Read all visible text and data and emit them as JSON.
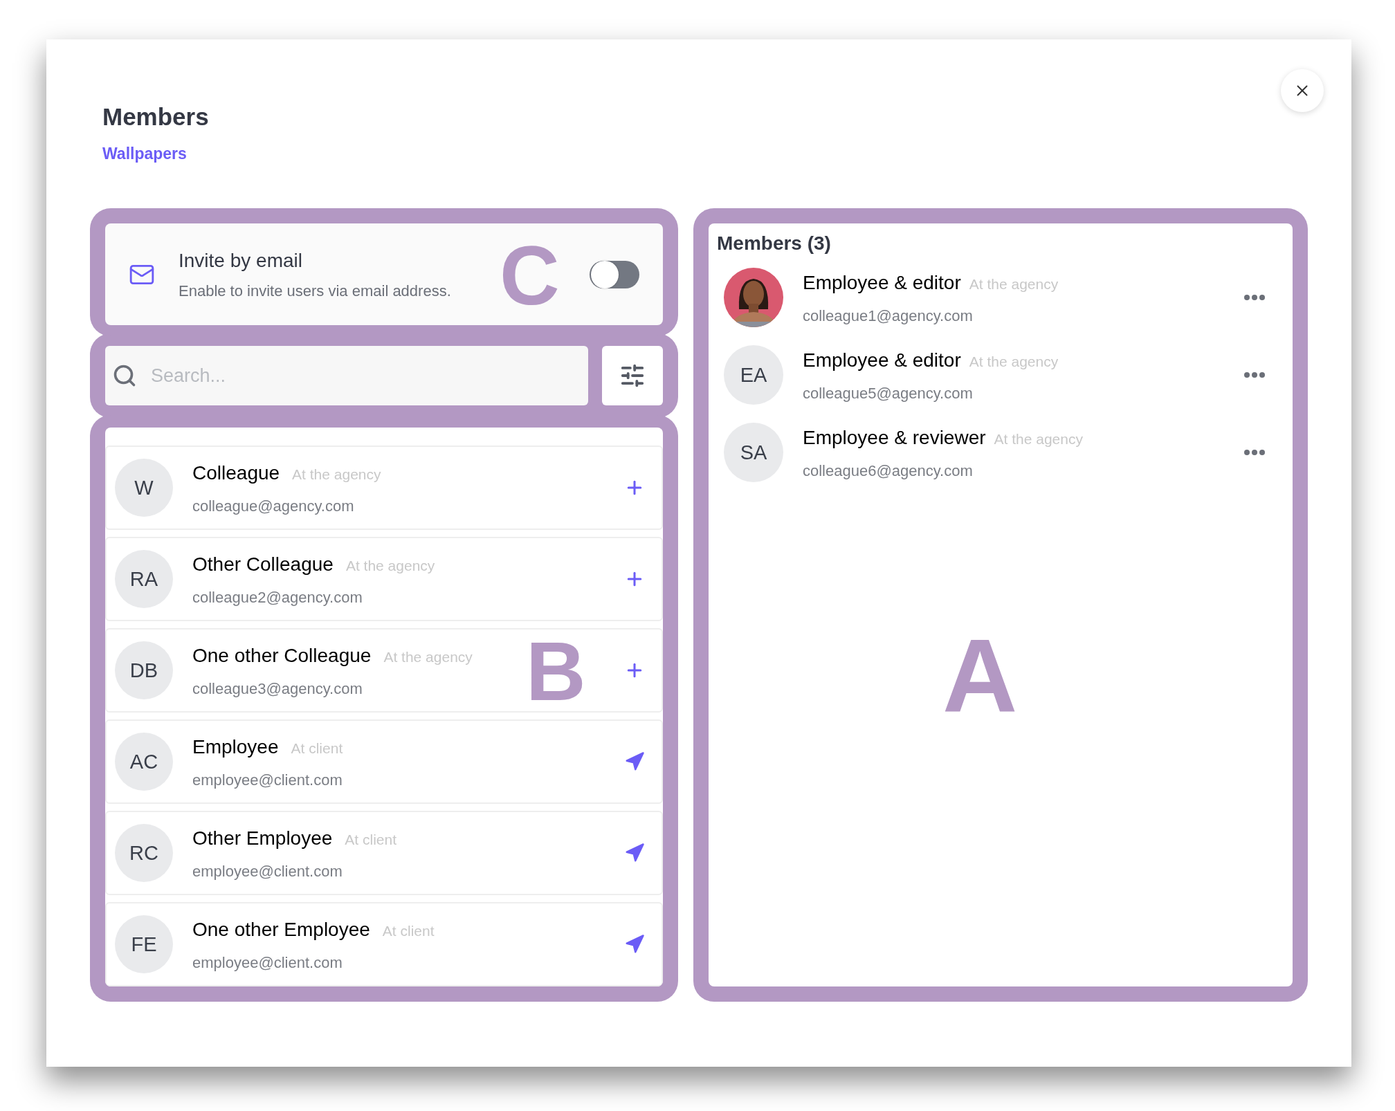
{
  "dialog": {
    "title": "Members",
    "subtitle": "Wallpapers"
  },
  "invite": {
    "title": "Invite by email",
    "description": "Enable to invite users via email address.",
    "on": false,
    "annotation": "C"
  },
  "search": {
    "placeholder": "Search..."
  },
  "candidates": {
    "annotation": "B",
    "rows": [
      {
        "initials": "W",
        "name": "Colleague",
        "org": "At the agency",
        "email": "colleague@agency.com",
        "kind": "add"
      },
      {
        "initials": "RA",
        "name": "Other Colleague",
        "org": "At the agency",
        "email": "colleague2@agency.com",
        "kind": "add"
      },
      {
        "initials": "DB",
        "name": "One other Colleague",
        "org": "At the agency",
        "email": "colleague3@agency.com",
        "kind": "add"
      },
      {
        "initials": "AC",
        "name": "Employee",
        "org": "At client",
        "email": "employee@client.com",
        "kind": "invite"
      },
      {
        "initials": "RC",
        "name": "Other Employee",
        "org": "At client",
        "email": "employee@client.com",
        "kind": "invite"
      },
      {
        "initials": "FE",
        "name": "One other Employee",
        "org": "At client",
        "email": "employee@client.com",
        "kind": "invite"
      }
    ]
  },
  "members": {
    "title": "Members (3)",
    "annotation": "A",
    "rows": [
      {
        "kind": "picture",
        "name": "Employee & editor",
        "org": "At the agency",
        "email": "colleague1@agency.com"
      },
      {
        "kind": "initials",
        "initials": "EA",
        "name": "Employee & editor",
        "org": "At the agency",
        "email": "colleague5@agency.com"
      },
      {
        "kind": "initials",
        "initials": "SA",
        "name": "Employee & reviewer",
        "org": "At the agency",
        "email": "colleague6@agency.com"
      }
    ]
  }
}
